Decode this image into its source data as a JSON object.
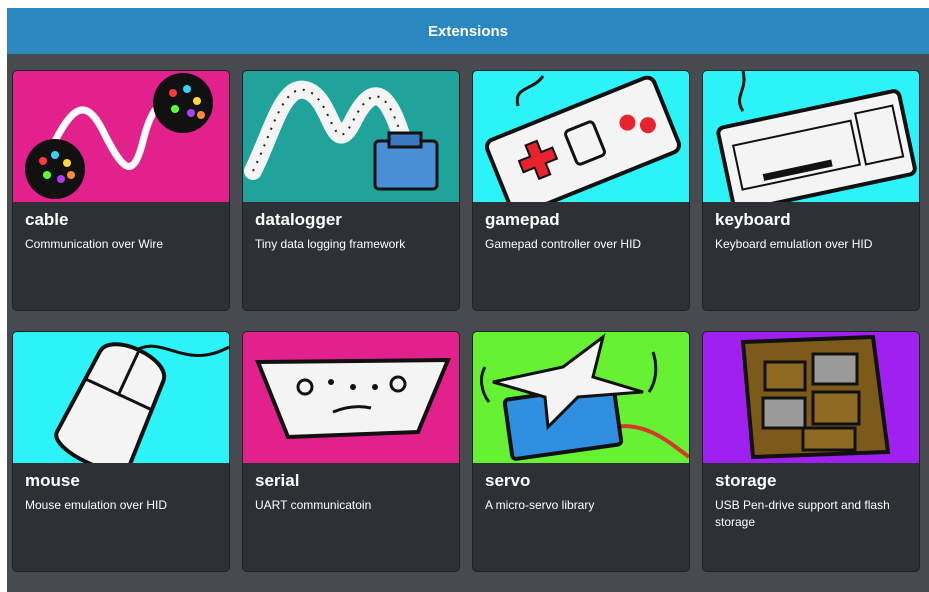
{
  "dialog": {
    "title": "Extensions"
  },
  "cards": [
    {
      "name": "cable",
      "description": "Communication over Wire",
      "art_bg": "#e3218c",
      "icon": "cable-icon"
    },
    {
      "name": "datalogger",
      "description": "Tiny data logging framework",
      "art_bg": "#1fa39a",
      "icon": "datalogger-icon"
    },
    {
      "name": "gamepad",
      "description": "Gamepad controller over HID",
      "art_bg": "#2cf3f7",
      "icon": "gamepad-icon"
    },
    {
      "name": "keyboard",
      "description": "Keyboard emulation over HID",
      "art_bg": "#2cf3f7",
      "icon": "keyboard-icon"
    },
    {
      "name": "mouse",
      "description": "Mouse emulation over HID",
      "art_bg": "#2cf3f7",
      "icon": "mouse-icon"
    },
    {
      "name": "serial",
      "description": "UART communicatoin",
      "art_bg": "#e3218c",
      "icon": "serial-icon"
    },
    {
      "name": "servo",
      "description": "A micro-servo library",
      "art_bg": "#66f132",
      "icon": "servo-icon"
    },
    {
      "name": "storage",
      "description": "USB Pen-drive support and flash storage",
      "art_bg": "#a020f0",
      "icon": "storage-icon"
    }
  ]
}
